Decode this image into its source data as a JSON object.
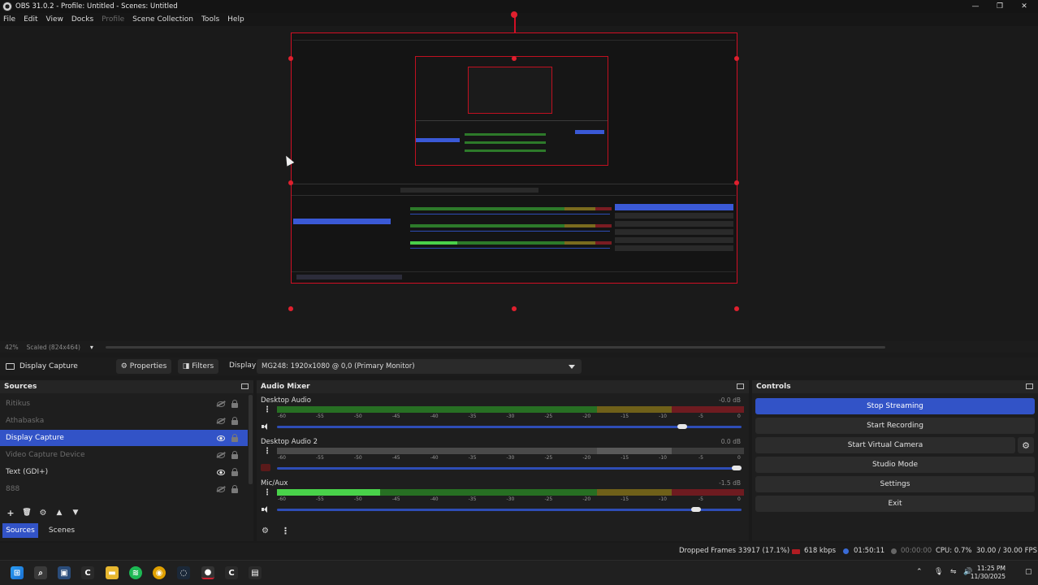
{
  "window": {
    "title": "OBS 31.0.2 - Profile: Untitled - Scenes: Untitled",
    "minimize": "—",
    "maximize": "❐",
    "close": "✕"
  },
  "menu": [
    "File",
    "Edit",
    "View",
    "Docks",
    "Profile",
    "Scene Collection",
    "Tools",
    "Help"
  ],
  "preview": {
    "zoom": "42%",
    "scaled": "Scaled (824x464)"
  },
  "source_toolbar": {
    "source_name": "Display Capture",
    "properties": "Properties",
    "filters": "Filters",
    "display_label": "Display",
    "display_value": "MG248: 1920x1080 @ 0,0 (Primary Monitor)"
  },
  "sources": {
    "title": "Sources",
    "items": [
      {
        "name": "Ritikus",
        "visible": false
      },
      {
        "name": "Athabaska",
        "visible": false
      },
      {
        "name": "Display Capture",
        "visible": true,
        "selected": true
      },
      {
        "name": "Video Capture Device",
        "visible": false
      },
      {
        "name": "Text (GDI+)",
        "visible": true
      },
      {
        "name": "888",
        "visible": false
      }
    ],
    "tabs": [
      "Sources",
      "Scenes"
    ]
  },
  "mixer": {
    "title": "Audio Mixer",
    "ticks": [
      "-60",
      "-55",
      "-50",
      "-45",
      "-40",
      "-35",
      "-30",
      "-25",
      "-20",
      "-15",
      "-10",
      "-5",
      "0"
    ],
    "channels": [
      {
        "name": "Desktop Audio",
        "db": "-0.0 dB",
        "volume": 0.88,
        "level": 0.0,
        "muted": false
      },
      {
        "name": "Desktop Audio 2",
        "db": "0.0 dB",
        "volume": 1.0,
        "level": 0.0,
        "muted": true
      },
      {
        "name": "Mic/Aux",
        "db": "-1.5 dB",
        "volume": 0.91,
        "level": 0.22,
        "muted": false
      }
    ]
  },
  "controls": {
    "title": "Controls",
    "buttons": [
      "Stop Streaming",
      "Start Recording",
      "Start Virtual Camera",
      "Studio Mode",
      "Settings",
      "Exit"
    ]
  },
  "status": {
    "dropped": "Dropped Frames 33917 (17.1%)",
    "bitrate": "618 kbps",
    "stream_time": "01:50:11",
    "rec_time": "00:00:00",
    "cpu": "CPU: 0.7%",
    "fps": "30.00 / 30.00 FPS"
  },
  "taskbar": {
    "time": "11:25 PM",
    "date": "11/30/2025"
  },
  "colors": {
    "accent": "#3253c7",
    "selection_red": "#d10f24"
  }
}
